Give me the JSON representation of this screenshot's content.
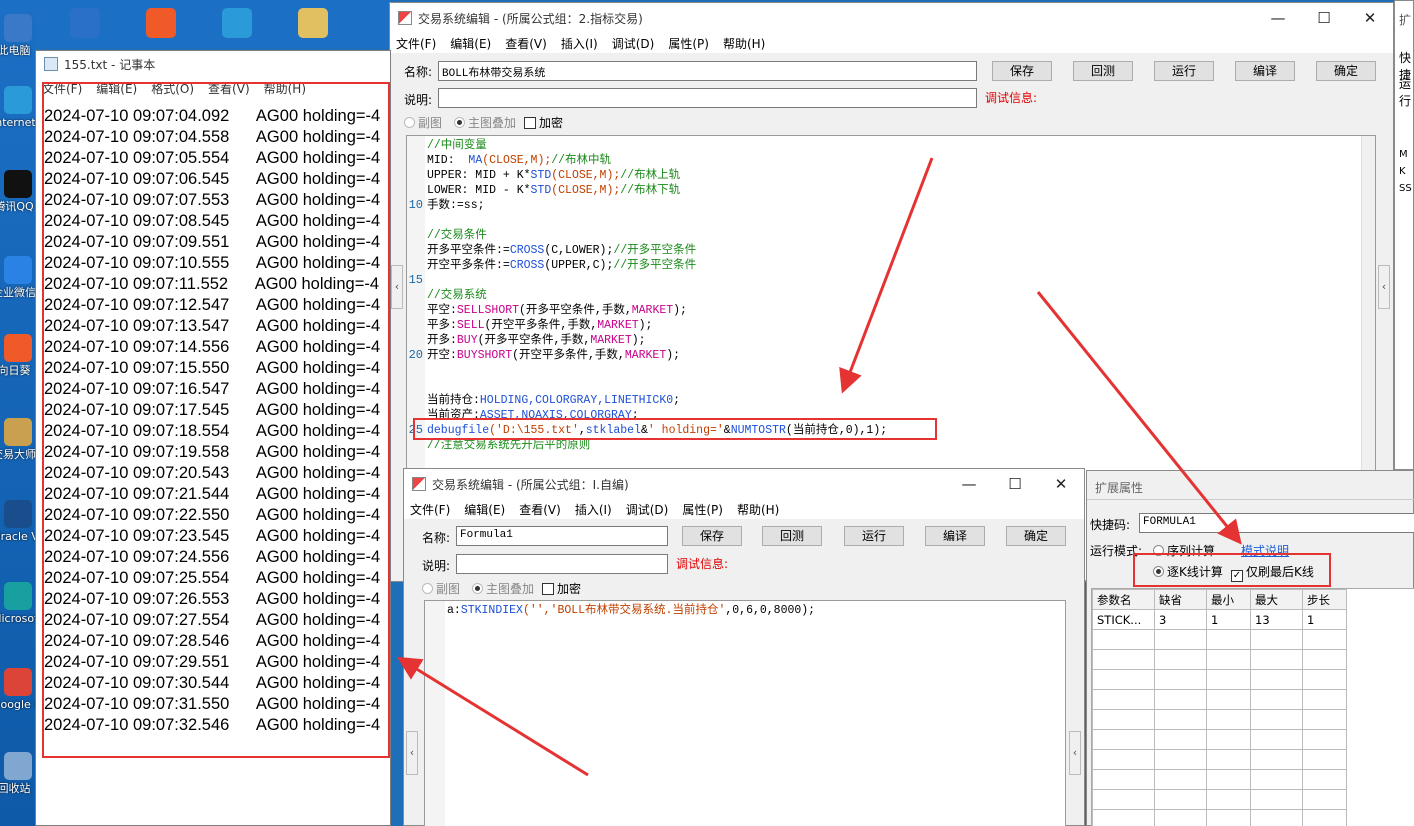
{
  "desktop_icons": [
    {
      "label": "此电脑",
      "icon": "computer-icon",
      "color": "#3a78c8"
    },
    {
      "label": "Internet Explorer",
      "icon": "ie-icon",
      "color": "#2a9ad8"
    },
    {
      "label": "腾讯QQ",
      "icon": "qq-icon",
      "color": "#111111"
    },
    {
      "label": "企业微信",
      "icon": "wecom-icon",
      "color": "#2a82e4"
    },
    {
      "label": "向日葵",
      "icon": "sunflower-icon",
      "color": "#f05a28"
    },
    {
      "label": "交易大师",
      "icon": "trade-master-icon",
      "color": "#c8a050"
    },
    {
      "label": "Oracle VM VirtualBox",
      "icon": "virtualbox-icon",
      "color": "#1a4d8c"
    },
    {
      "label": "Microsoft Edge",
      "icon": "edge-icon",
      "color": "#18a0a0"
    },
    {
      "label": "Google Chrome",
      "icon": "chrome-icon",
      "color": "#db4437"
    },
    {
      "label": "回收站",
      "icon": "recycle-bin-icon",
      "color": "#7fa7d0"
    }
  ],
  "top_icons": [
    {
      "icon": "pen-app-icon",
      "color": "#2a70c8"
    },
    {
      "icon": "video-app-icon",
      "color": "#f05a28"
    },
    {
      "icon": "t-app-icon",
      "color": "#2a9ad8"
    },
    {
      "icon": "folder-icon",
      "color": "#e0c060"
    }
  ],
  "notepad": {
    "title": "155.txt - 记事本",
    "menus": [
      "文件(F)",
      "编辑(E)",
      "格式(O)",
      "查看(V)",
      "帮助(H)"
    ],
    "lines": [
      "2024-07-10 09:07:04.092      AG00 holding=-4",
      "2024-07-10 09:07:04.558      AG00 holding=-4",
      "2024-07-10 09:07:05.554      AG00 holding=-4",
      "2024-07-10 09:07:06.545      AG00 holding=-4",
      "2024-07-10 09:07:07.553      AG00 holding=-4",
      "2024-07-10 09:07:08.545      AG00 holding=-4",
      "2024-07-10 09:07:09.551      AG00 holding=-4",
      "2024-07-10 09:07:10.555      AG00 holding=-4",
      "2024-07-10 09:07:11.552      AG00 holding=-4",
      "2024-07-10 09:07:12.547      AG00 holding=-4",
      "2024-07-10 09:07:13.547      AG00 holding=-4",
      "2024-07-10 09:07:14.556      AG00 holding=-4",
      "2024-07-10 09:07:15.550      AG00 holding=-4",
      "2024-07-10 09:07:16.547      AG00 holding=-4",
      "2024-07-10 09:07:17.545      AG00 holding=-4",
      "2024-07-10 09:07:18.554      AG00 holding=-4",
      "2024-07-10 09:07:19.558      AG00 holding=-4",
      "2024-07-10 09:07:20.543      AG00 holding=-4",
      "2024-07-10 09:07:21.544      AG00 holding=-4",
      "2024-07-10 09:07:22.550      AG00 holding=-4",
      "2024-07-10 09:07:23.545      AG00 holding=-4",
      "2024-07-10 09:07:24.556      AG00 holding=-4",
      "2024-07-10 09:07:25.554      AG00 holding=-4",
      "2024-07-10 09:07:26.553      AG00 holding=-4",
      "2024-07-10 09:07:27.554      AG00 holding=-4",
      "2024-07-10 09:07:28.546      AG00 holding=-4",
      "2024-07-10 09:07:29.551      AG00 holding=-4",
      "2024-07-10 09:07:30.544      AG00 holding=-4",
      "2024-07-10 09:07:31.550      AG00 holding=-4",
      "2024-07-10 09:07:32.546      AG00 holding=-4"
    ]
  },
  "editor1": {
    "title": "交易系统编辑 - (所属公式组：2.指标交易)",
    "menus": [
      "文件(F)",
      "编辑(E)",
      "查看(V)",
      "插入(I)",
      "调试(D)",
      "属性(P)",
      "帮助(H)"
    ],
    "name_label": "名称:",
    "name_value": "BOLL布林带交易系统",
    "desc_label": "说明:",
    "desc_value": "",
    "debug_info": "调试信息:",
    "buttons": [
      "保存",
      "回测",
      "运行",
      "编译",
      "确定"
    ],
    "radio_sub": "副图",
    "radio_main": "主图叠加",
    "check_encrypt": "加密",
    "line_numbers": [
      {
        "n": "10",
        "row": 4
      },
      {
        "n": "15",
        "row": 9
      },
      {
        "n": "20",
        "row": 14
      },
      {
        "n": "25",
        "row": 19
      }
    ],
    "code": [
      [
        {
          "t": "//中间变量",
          "c": "cm"
        }
      ],
      [
        {
          "t": "MID:  ",
          "c": "cn"
        },
        {
          "t": "MA",
          "c": "fn"
        },
        {
          "t": "(CLOSE,M);",
          "c": "st"
        },
        {
          "t": "//布林中轨",
          "c": "cm"
        }
      ],
      [
        {
          "t": "UPPER: MID + K*",
          "c": "cn"
        },
        {
          "t": "STD",
          "c": "fn"
        },
        {
          "t": "(CLOSE,M);",
          "c": "st"
        },
        {
          "t": "//布林上轨",
          "c": "cm"
        }
      ],
      [
        {
          "t": "LOWER: MID - K*",
          "c": "cn"
        },
        {
          "t": "STD",
          "c": "fn"
        },
        {
          "t": "(CLOSE,M);",
          "c": "st"
        },
        {
          "t": "//布林下轨",
          "c": "cm"
        }
      ],
      [
        {
          "t": "手数:=ss;",
          "c": "cn"
        }
      ],
      [
        {
          "t": "",
          "c": "cn"
        }
      ],
      [
        {
          "t": "//交易条件",
          "c": "cm"
        }
      ],
      [
        {
          "t": "开多平空条件:=",
          "c": "cn"
        },
        {
          "t": "CROSS",
          "c": "fn"
        },
        {
          "t": "(C,LOWER);",
          "c": "cn"
        },
        {
          "t": "//开多平空条件",
          "c": "cm"
        }
      ],
      [
        {
          "t": "开空平多条件:=",
          "c": "cn"
        },
        {
          "t": "CROSS",
          "c": "fn"
        },
        {
          "t": "(UPPER,C);",
          "c": "cn"
        },
        {
          "t": "//开多平空条件",
          "c": "cm"
        }
      ],
      [
        {
          "t": "",
          "c": "cn"
        }
      ],
      [
        {
          "t": "//交易系统",
          "c": "cm"
        }
      ],
      [
        {
          "t": "平空:",
          "c": "cn"
        },
        {
          "t": "SELLSHORT",
          "c": "kw"
        },
        {
          "t": "(开多平空条件,手数,",
          "c": "cn"
        },
        {
          "t": "MARKET",
          "c": "kw"
        },
        {
          "t": ");",
          "c": "cn"
        }
      ],
      [
        {
          "t": "平多:",
          "c": "cn"
        },
        {
          "t": "SELL",
          "c": "kw"
        },
        {
          "t": "(开空平多条件,手数,",
          "c": "cn"
        },
        {
          "t": "MARKET",
          "c": "kw"
        },
        {
          "t": ");",
          "c": "cn"
        }
      ],
      [
        {
          "t": "开多:",
          "c": "cn"
        },
        {
          "t": "BUY",
          "c": "kw"
        },
        {
          "t": "(开多平空条件,手数,",
          "c": "cn"
        },
        {
          "t": "MARKET",
          "c": "kw"
        },
        {
          "t": ");",
          "c": "cn"
        }
      ],
      [
        {
          "t": "开空:",
          "c": "cn"
        },
        {
          "t": "BUYSHORT",
          "c": "kw"
        },
        {
          "t": "(开空平多条件,手数,",
          "c": "cn"
        },
        {
          "t": "MARKET",
          "c": "kw"
        },
        {
          "t": ");",
          "c": "cn"
        }
      ],
      [
        {
          "t": "",
          "c": "cn"
        }
      ],
      [
        {
          "t": "",
          "c": "cn"
        }
      ],
      [
        {
          "t": "当前持仓:",
          "c": "cn"
        },
        {
          "t": "HOLDING,COLORGRAY,LINETHICK0",
          "c": "fn"
        },
        {
          "t": ";",
          "c": "cn"
        }
      ],
      [
        {
          "t": "当前资产:",
          "c": "cn"
        },
        {
          "t": "ASSET,NOAXIS,COLORGRAY",
          "c": "fn"
        },
        {
          "t": ";",
          "c": "cn"
        }
      ],
      [
        {
          "t": "debugfile",
          "c": "fn"
        },
        {
          "t": "('D:\\155.txt'",
          "c": "st"
        },
        {
          "t": ",",
          "c": "cn"
        },
        {
          "t": "stklabel",
          "c": "fn"
        },
        {
          "t": "&",
          "c": "cn"
        },
        {
          "t": "' holding='",
          "c": "st"
        },
        {
          "t": "&",
          "c": "cn"
        },
        {
          "t": "NUMTOSTR",
          "c": "fn"
        },
        {
          "t": "(当前持仓,0),1);",
          "c": "cn"
        }
      ],
      [
        {
          "t": "//注意交易系统先开后平的原则",
          "c": "cm"
        }
      ]
    ]
  },
  "editor2": {
    "title": "交易系统编辑 - (所属公式组：I.自编)",
    "menus": [
      "文件(F)",
      "编辑(E)",
      "查看(V)",
      "插入(I)",
      "调试(D)",
      "属性(P)",
      "帮助(H)"
    ],
    "name_label": "名称:",
    "name_value": "Formula1",
    "desc_label": "说明:",
    "desc_value": "",
    "debug_info": "调试信息:",
    "buttons": [
      "保存",
      "回测",
      "运行",
      "编译",
      "确定"
    ],
    "radio_sub": "副图",
    "radio_main": "主图叠加",
    "check_encrypt": "加密",
    "code": [
      [
        {
          "t": "a:",
          "c": "cn"
        },
        {
          "t": "STKINDIEX",
          "c": "fn"
        },
        {
          "t": "('','BOLL布林带交易系统.当前持仓'",
          "c": "st"
        },
        {
          "t": ",0,6,0,8000);",
          "c": "cn"
        }
      ]
    ]
  },
  "ext": {
    "title": "扩展属性",
    "shortcut_label": "快捷码:",
    "shortcut_value": "FORMULA1",
    "mode_label": "运行模式:",
    "mode_seq": "序列计算",
    "mode_link": "模式说明",
    "mode_per_bar": "逐K线计算",
    "refresh_last": "仅刷最后K线",
    "headers": [
      "参数名",
      "缺省",
      "最小",
      "最大",
      "步长"
    ],
    "rows": [
      [
        "STICK...",
        "3",
        "1",
        "13",
        "1"
      ]
    ]
  },
  "bg_window": {
    "title_fragment": "扩",
    "shortcut_fragment": "快捷",
    "mode_fragment": "运行",
    "rows": [
      "M",
      "K",
      "SS"
    ]
  },
  "window_buttons": {
    "minimize": "—",
    "maximize": "☐",
    "close": "✕"
  },
  "accent": "#e53333"
}
